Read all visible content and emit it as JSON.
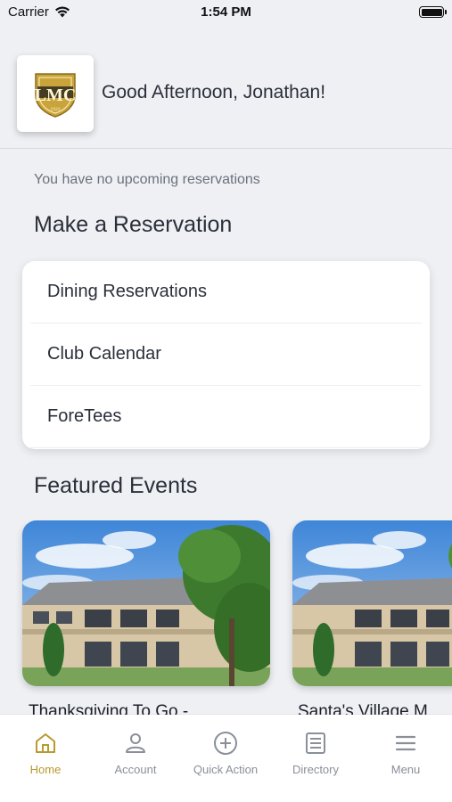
{
  "status_bar": {
    "carrier": "Carrier",
    "time": "1:54 PM"
  },
  "header": {
    "greeting": "Good Afternoon, Jonathan!",
    "logo_text": "LMC",
    "logo_year": "1922"
  },
  "reservations": {
    "empty_message": "You have no upcoming reservations",
    "section_title": "Make a Reservation",
    "items": [
      {
        "label": "Dining Reservations"
      },
      {
        "label": "Club Calendar"
      },
      {
        "label": "ForeTees"
      }
    ]
  },
  "featured": {
    "section_title": "Featured Events",
    "events": [
      {
        "title": "Thanksgiving To Go -"
      },
      {
        "title": "Santa's Village M"
      }
    ]
  },
  "tab_bar": {
    "tabs": [
      {
        "label": "Home",
        "icon": "home-icon",
        "active": true
      },
      {
        "label": "Account",
        "icon": "account-icon",
        "active": false
      },
      {
        "label": "Quick Action",
        "icon": "plus-circle-icon",
        "active": false
      },
      {
        "label": "Directory",
        "icon": "directory-icon",
        "active": false
      },
      {
        "label": "Menu",
        "icon": "menu-icon",
        "active": false
      }
    ]
  },
  "colors": {
    "accent": "#b89a2e",
    "background": "#eef0f4",
    "text": "#2b2f3a",
    "muted": "#8a8f99"
  }
}
